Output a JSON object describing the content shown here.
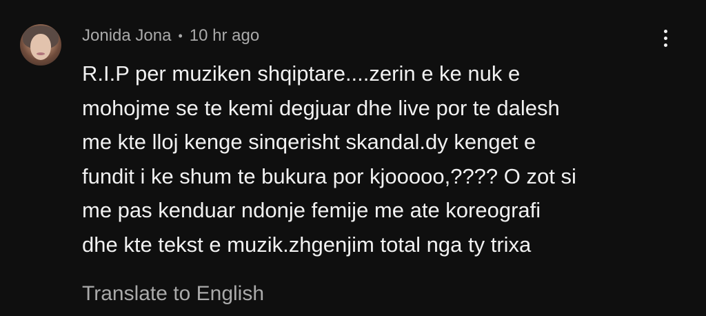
{
  "comment": {
    "author": "Jonida Jona",
    "separator": "•",
    "timestamp": "10 hr ago",
    "text_lines": [
      "R.I.P per muziken shqiptare....zerin e ke nuk e",
      "mohojme se te kemi degjuar dhe live por te dalesh",
      "me kte lloj kenge sinqerisht skandal.dy kenget e",
      "fundit i ke shum te bukura por kjooooo,???? O zot si",
      "me pas kenduar ndonje femije me ate koreografi",
      "dhe kte tekst e muzik.zhgenjim total nga ty trixa"
    ],
    "translate_label": "Translate to English",
    "menu_icon": "more-vert-icon",
    "avatar_icon": "user-avatar"
  },
  "colors": {
    "background": "#0f0f0f",
    "primary_text": "#f1f1f1",
    "secondary_text": "#aaaaaa"
  }
}
